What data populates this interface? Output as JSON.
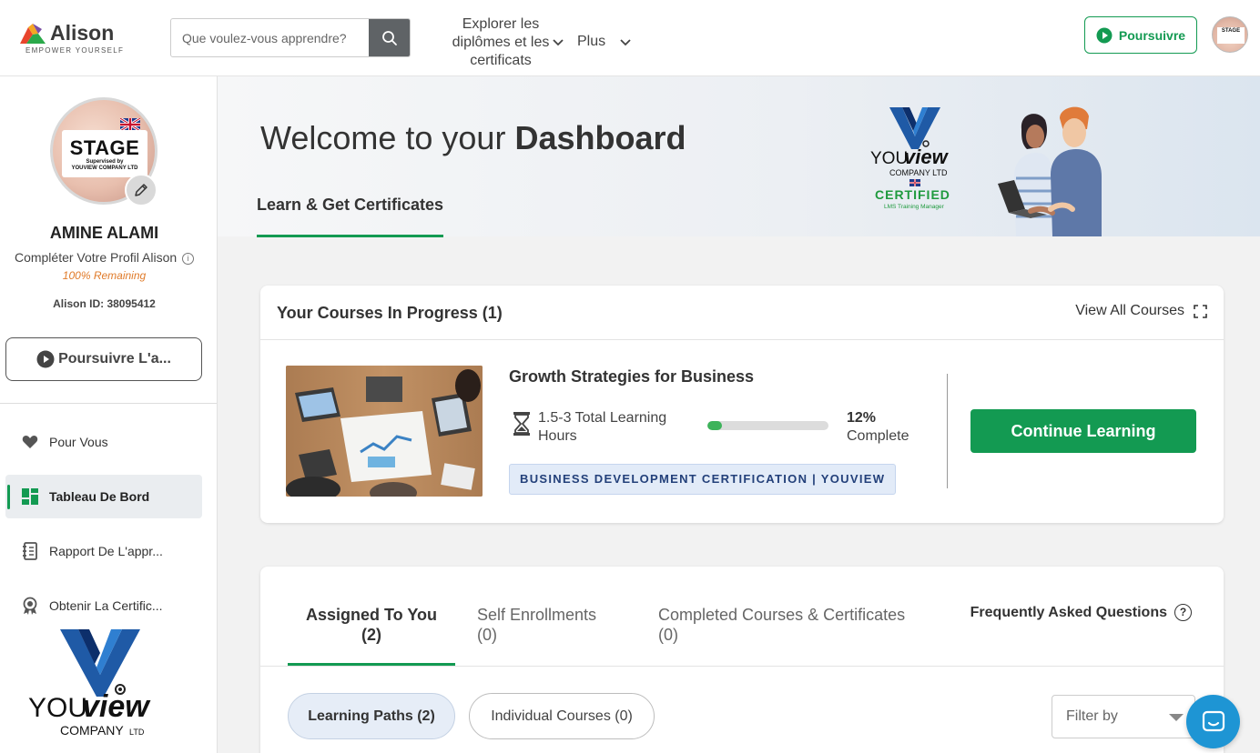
{
  "header": {
    "logo_name": "Alison",
    "logo_tagline": "EMPOWER YOURSELF",
    "search_placeholder": "Que voulez-vous apprendre?",
    "nav_explore": "Explorer les diplômes et les certificats",
    "nav_more": "Plus",
    "resume_label": "Poursuivre",
    "avatar_card_text": "STAGE"
  },
  "sidebar": {
    "avatar_card_title": "STAGE",
    "avatar_card_sub1": "Supervised by",
    "avatar_card_sub2": "YOUVIEW COMPANY LTD",
    "user_name": "AMINE ALAMI",
    "complete_profile": "Compléter Votre Profil Alison",
    "remaining": "100% Remaining",
    "alison_id": "Alison ID: 38095412",
    "resume_label": "Poursuivre L'a...",
    "items": [
      {
        "label": "Pour Vous",
        "icon": "heart-icon"
      },
      {
        "label": "Tableau De Bord",
        "icon": "dashboard-icon",
        "active": true
      },
      {
        "label": "Rapport De L'appr...",
        "icon": "notebook-icon"
      },
      {
        "label": "Obtenir La Certific...",
        "icon": "award-icon"
      }
    ],
    "brand_you": "YOU",
    "brand_view": "view",
    "brand_company": "COMPANY",
    "brand_ltd": "LTD"
  },
  "banner": {
    "welcome_prefix": "Welcome to your ",
    "welcome_bold": "Dashboard",
    "tab_label": "Learn & Get Certificates",
    "logo_you": "YOU",
    "logo_view": "view",
    "logo_company": "COMPANY LTD",
    "logo_certified": "CERTIFIED",
    "logo_sub": "LMS Training Manager"
  },
  "in_progress": {
    "title": "Your Courses In Progress (1)",
    "view_all": "View All Courses",
    "course_name": "Growth Strategies for Business",
    "hours": "1.5-3 Total Learning Hours",
    "progress_percent": 12,
    "percent_label": "12%",
    "complete_label": "Complete",
    "certification": "BUSINESS DEVELOPMENT CERTIFICATION | YOUVIEW",
    "continue_label": "Continue Learning"
  },
  "tabs": {
    "items": [
      {
        "label": "Assigned To You",
        "count": "(2)",
        "active": true
      },
      {
        "label": "Self Enrollments",
        "count": "(0)"
      },
      {
        "label": "Completed Courses & Certificates",
        "count": "(0)"
      }
    ],
    "faq": "Frequently Asked Questions",
    "pill_paths": "Learning Paths (2)",
    "pill_individual": "Individual Courses (0)",
    "filter_placeholder": "Filter by"
  },
  "colors": {
    "accent_green": "#139a52",
    "progress_green": "#3db35a",
    "warning_orange": "#e07b2a",
    "badge_navy": "#23407a",
    "chat_blue": "#1e95d4"
  }
}
